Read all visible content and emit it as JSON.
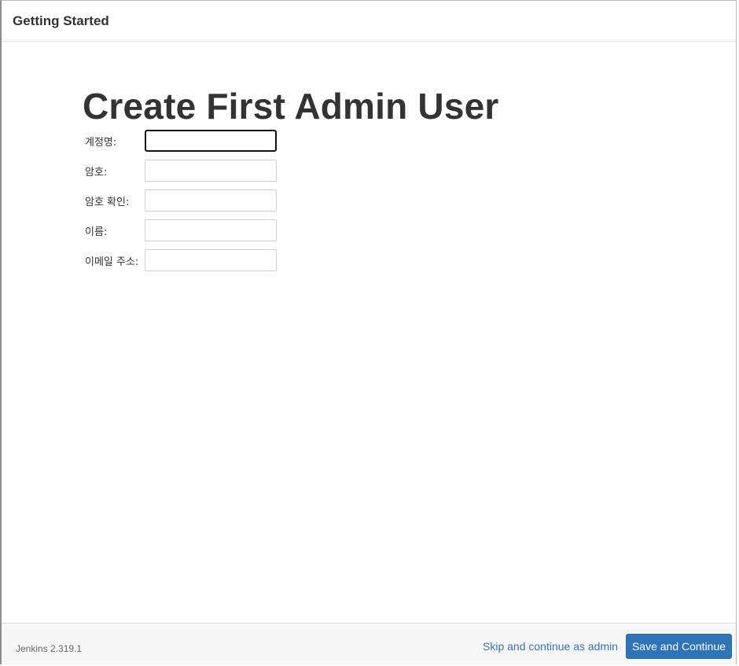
{
  "header": {
    "title": "Getting Started"
  },
  "main": {
    "title": "Create First Admin User",
    "fields": [
      {
        "label": "계정명:",
        "value": "",
        "placeholder": ""
      },
      {
        "label": "암호:",
        "value": "",
        "placeholder": ""
      },
      {
        "label": "암호 확인:",
        "value": "",
        "placeholder": ""
      },
      {
        "label": "이름:",
        "value": "",
        "placeholder": ""
      },
      {
        "label": "이메일 주소:",
        "value": "",
        "placeholder": ""
      }
    ]
  },
  "footer": {
    "version": "Jenkins 2.319.1",
    "skip_label": "Skip and continue as admin",
    "save_label": "Save and Continue"
  },
  "colors": {
    "primary_button": "#2e74b6",
    "link": "#3a73b3",
    "text": "#333333"
  }
}
